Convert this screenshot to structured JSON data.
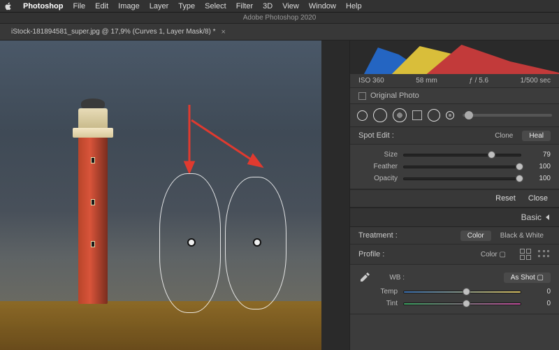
{
  "menubar": {
    "items": [
      "Photoshop",
      "File",
      "Edit",
      "Image",
      "Layer",
      "Type",
      "Select",
      "Filter",
      "3D",
      "View",
      "Window",
      "Help"
    ]
  },
  "titlebar": "Adobe Photoshop 2020",
  "tab": {
    "label": "iStock-181894581_super.jpg @ 17,9% (Curves 1, Layer Mask/8) *"
  },
  "histogram_meta": {
    "iso": "ISO 360",
    "focal": "58 mm",
    "aperture": "ƒ / 5.6",
    "shutter": "1/500 sec"
  },
  "orig_photo": "Original Photo",
  "spot": {
    "title": "Spot Edit :",
    "modes": [
      "Clone",
      "Heal"
    ],
    "sliders": [
      {
        "label": "Size",
        "value": 79,
        "pos": 72
      },
      {
        "label": "Feather",
        "value": 100,
        "pos": 96
      },
      {
        "label": "Opacity",
        "value": 100,
        "pos": 96
      }
    ],
    "buttons": [
      "Reset",
      "Close"
    ]
  },
  "basic": {
    "title": "Basic",
    "treatment": {
      "label": "Treatment :",
      "options": [
        "Color",
        "Black & White"
      ]
    },
    "profile": {
      "label": "Profile :",
      "value": "Color"
    },
    "wb": {
      "label": "WB :",
      "value": "As Shot"
    },
    "sliders": [
      {
        "label": "Temp",
        "value": 0,
        "pos": 50
      },
      {
        "label": "Tint",
        "value": 0,
        "pos": 50
      }
    ]
  }
}
